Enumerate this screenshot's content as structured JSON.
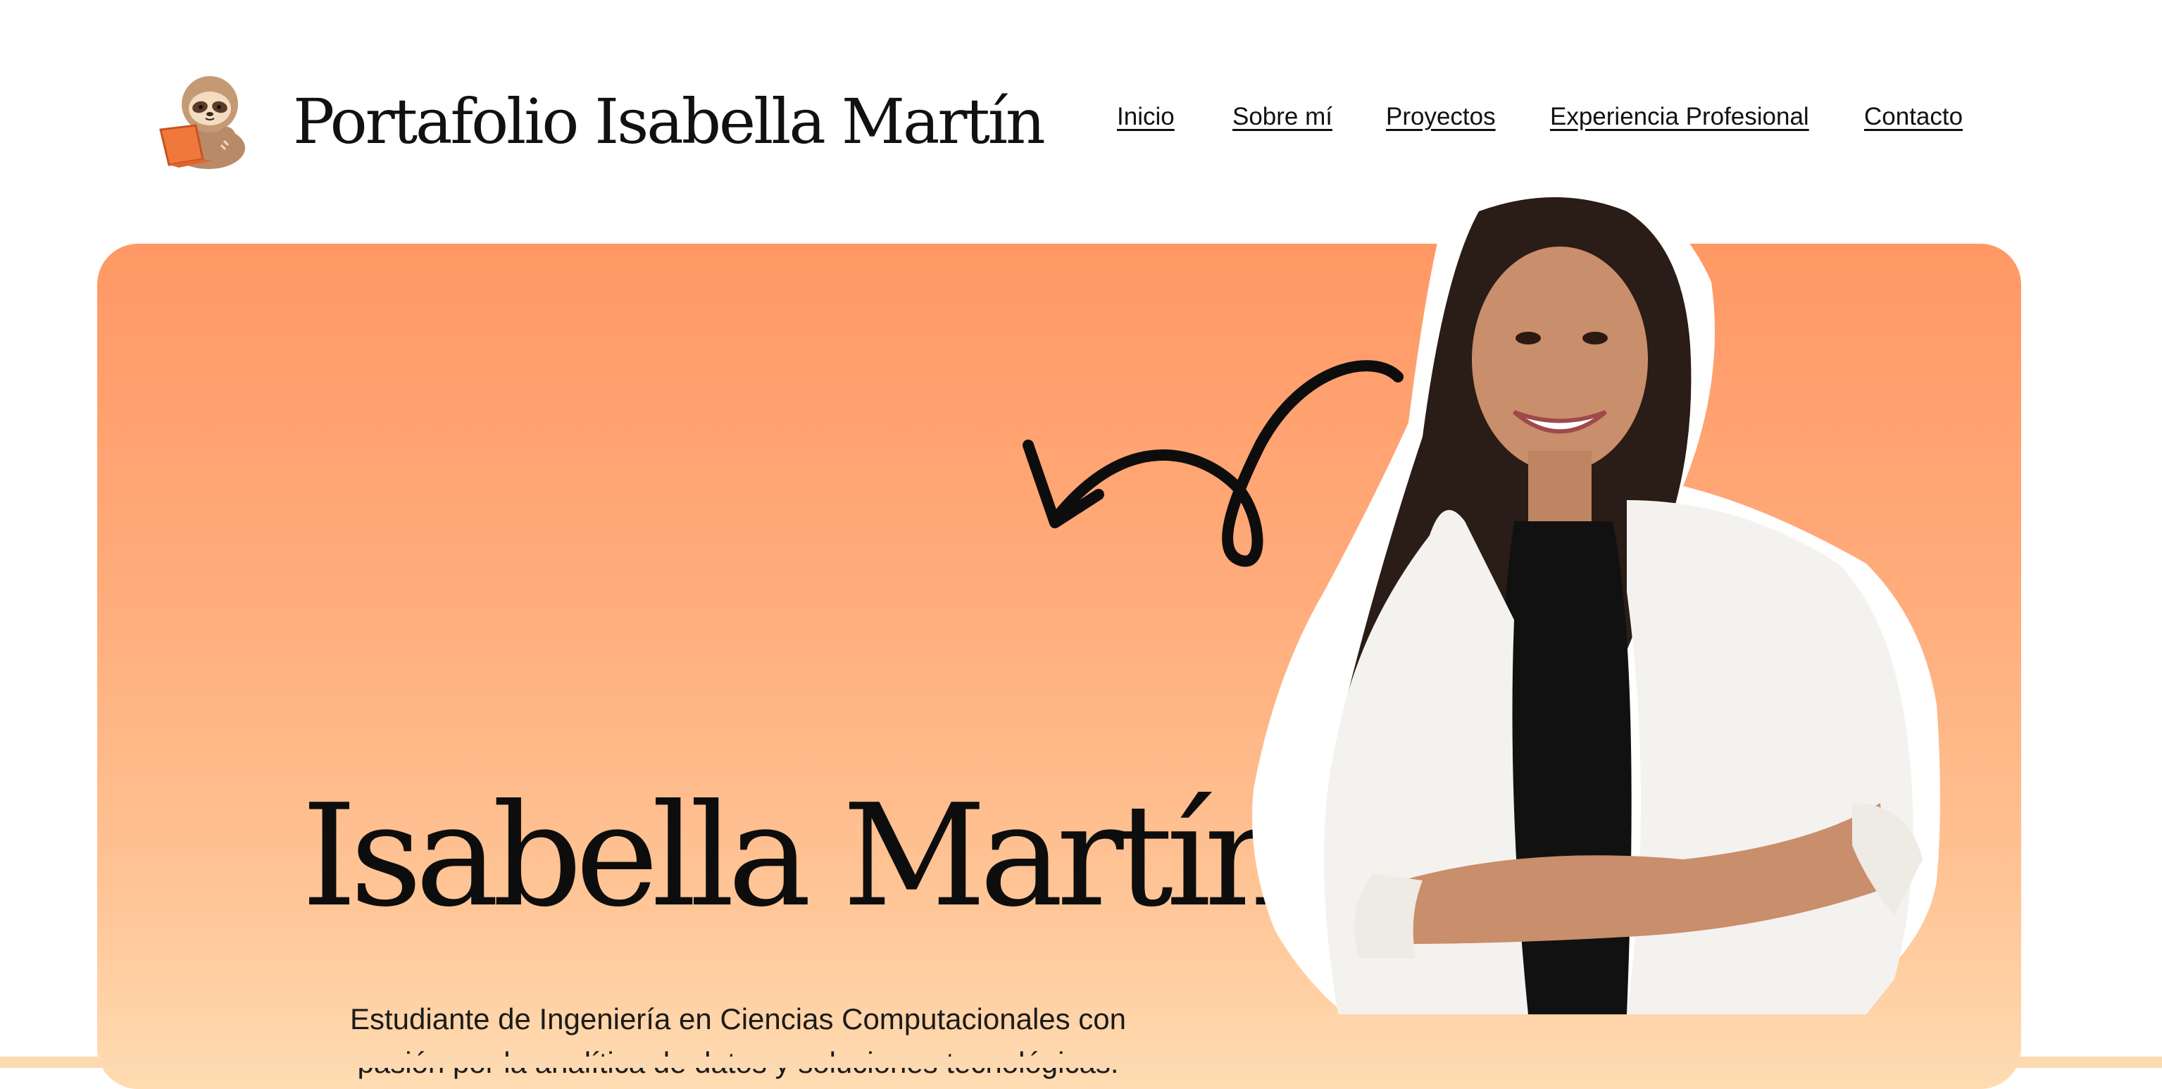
{
  "header": {
    "logo_icon": "sloth-with-laptop-icon",
    "title": "Portafolio Isabella Martín",
    "nav": [
      {
        "label": "Inicio"
      },
      {
        "label": "Sobre mí"
      },
      {
        "label": "Proyectos"
      },
      {
        "label": "Experiencia Profesional"
      },
      {
        "label": "Contacto"
      }
    ]
  },
  "hero": {
    "name": "Isabella Martín",
    "description_line1": "Estudiante de Ingeniería en Ciencias Computacionales con",
    "description_line2": "pasión por la analítica de datos y soluciones tecnológicas.",
    "arrow_icon": "curly-arrow-icon",
    "photo": "profile-photo"
  },
  "colors": {
    "gradient_top": "#ff9865",
    "gradient_bottom": "#ffdcb2",
    "text": "#111111"
  }
}
